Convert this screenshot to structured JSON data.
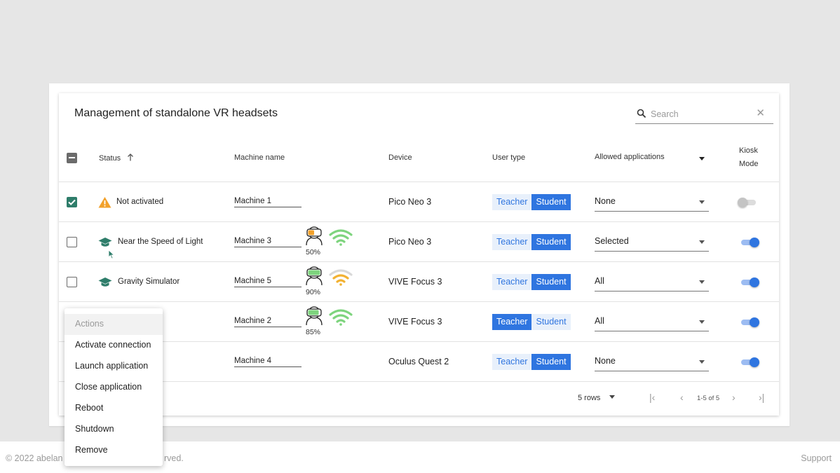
{
  "panel": {
    "title": "Management of standalone VR headsets"
  },
  "search": {
    "placeholder": "Search"
  },
  "columns": {
    "status": "Status",
    "machine": "Machine name",
    "device": "Device",
    "user_type": "User type",
    "apps": "Allowed applications",
    "kiosk_1": "Kiosk",
    "kiosk_2": "Mode"
  },
  "colors": {
    "accent": "#2f75e0",
    "check": "#2e7d6a",
    "warning": "#f2a12b",
    "wifi_green": "#7ed47e",
    "wifi_orange": "#f2b233"
  },
  "user_type_labels": {
    "teacher": "Teacher",
    "student": "Student"
  },
  "rows": [
    {
      "checked": true,
      "status_icon": "warning-icon",
      "status": "Not activated",
      "machine": "Machine 1",
      "battery": null,
      "wifi": null,
      "device": "Pico Neo 3",
      "user_type": "Student",
      "apps": "None",
      "kiosk": false
    },
    {
      "checked": false,
      "status_icon": "graduation-cap-icon",
      "status": "Near the Speed of Light",
      "machine": "Machine 3",
      "battery": "50%",
      "wifi": "full-green",
      "device": "Pico Neo 3",
      "user_type": "Student",
      "apps": "Selected",
      "kiosk": true
    },
    {
      "checked": false,
      "status_icon": "graduation-cap-icon",
      "status": "Gravity Simulator",
      "machine": "Machine 5",
      "battery": "90%",
      "wifi": "weak-orange",
      "device": "VIVE Focus 3",
      "user_type": "Student",
      "apps": "All",
      "kiosk": true
    },
    {
      "checked": false,
      "status_icon": null,
      "status": "",
      "machine": "Machine 2",
      "battery": "85%",
      "wifi": "full-green",
      "device": "VIVE Focus 3",
      "user_type": "Teacher",
      "apps": "All",
      "kiosk": true
    },
    {
      "checked": false,
      "status_icon": null,
      "status": "",
      "machine": "Machine 4",
      "battery": null,
      "wifi": null,
      "device": "Oculus Quest 2",
      "user_type": "Student",
      "apps": "None",
      "kiosk": true
    }
  ],
  "pagination": {
    "rows_per_page": "5 rows",
    "range": "1-5 of 5"
  },
  "menu": {
    "header": "Actions",
    "items": [
      "Activate connection",
      "Launch application",
      "Close application",
      "Reboot",
      "Shutdown",
      "Remove"
    ]
  },
  "footer": {
    "copyright": "© 2022 abelan",
    "copyright_tail": "rved.",
    "support": "Support"
  }
}
